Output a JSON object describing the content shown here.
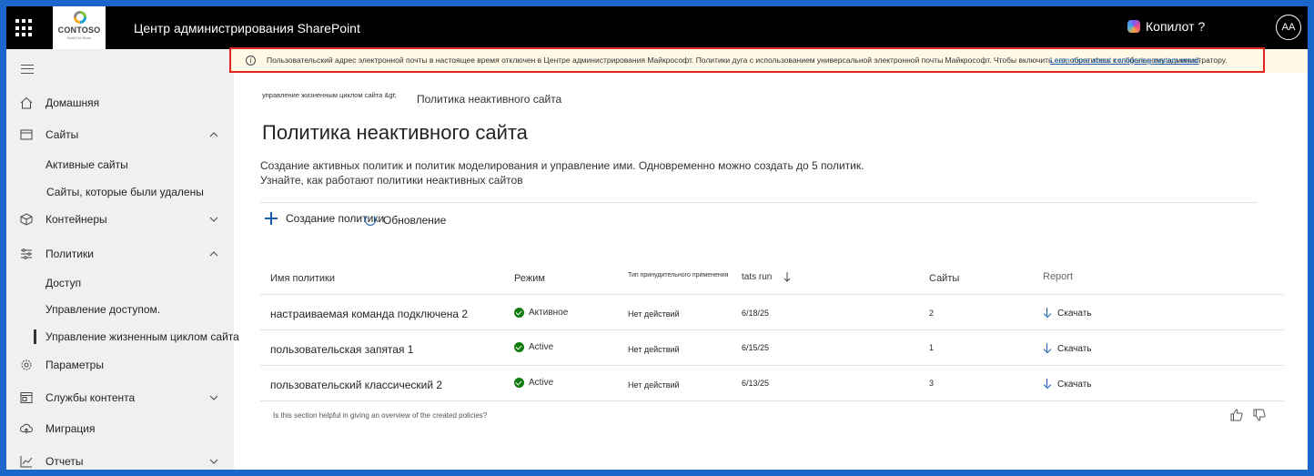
{
  "topbar": {
    "app_title": "Центр администрирования SharePoint",
    "logo_text": "CONTOSO",
    "logo_sub": "Build Ltd Story",
    "copilot_label": "Копилот ?",
    "avatar_initials": "AA"
  },
  "banner": {
    "text": "Пользовательский адрес электронной почты в настоящее время отключен в Центре администрирования Майкрософт. Политики дуга с использованием универсальной электронной почты Майкрософт. Чтобы включить его, обратитесь к глобальному администратору.",
    "link": "Learn more about configuring custom email"
  },
  "sidebar": {
    "items": [
      {
        "label": "Домашняя",
        "icon": "home-icon"
      },
      {
        "label": "Сайты",
        "icon": "sites-icon",
        "expanded": true
      },
      {
        "label": "Активные сайты"
      },
      {
        "label": "Сайты, которые были удалены"
      },
      {
        "label": "Контейнеры",
        "icon": "containers-icon",
        "expanded": false
      },
      {
        "label": "Политики",
        "icon": "policies-icon",
        "expanded": true
      },
      {
        "label": "Доступ"
      },
      {
        "label": "Управление доступом."
      },
      {
        "label": "Управление жизненным циклом сайта",
        "selected": true
      },
      {
        "label": "Параметры",
        "icon": "settings-icon"
      },
      {
        "label": "Службы контента",
        "icon": "content-services-icon",
        "expanded": false
      },
      {
        "label": "Миграция",
        "icon": "migration-icon"
      },
      {
        "label": "Отчеты",
        "icon": "reports-icon",
        "expanded": false
      }
    ]
  },
  "main": {
    "breadcrumb_parent": "управление жизненным циклом сайта &gt;",
    "breadcrumb_current": "Политика неактивного сайта",
    "title": "Политика неактивного сайта",
    "description": "Создание активных политик и политик моделирования и управление ими. Одновременно можно создать до 5 политик.",
    "learn_link": "Узнайте, как работают политики неактивных сайтов",
    "create_label": "Создание политики",
    "refresh_label": "Обновление"
  },
  "table": {
    "headers": {
      "name": "Имя политики",
      "mode": "Режим",
      "enforcement": "Тип принудительного применения",
      "last_run": "tats run",
      "sites": "Сайты",
      "report": "Report"
    },
    "rows": [
      {
        "name": "настраиваемая команда подключена 2",
        "mode": "Активное",
        "enforcement": "Нет действий",
        "last_run": "6/18/25",
        "sites": "2",
        "report": "Скачать"
      },
      {
        "name": "пользовательская запятая 1",
        "mode": "Active",
        "enforcement": "Нет действий",
        "last_run": "6/15/25",
        "sites": "1",
        "report": "Скачать"
      },
      {
        "name": "пользовательский классический 2",
        "mode": "Active",
        "enforcement": "Нет действий",
        "last_run": "6/13/25",
        "sites": "3",
        "report": "Скачать"
      }
    ],
    "feedback_question": "Is this section helpful in giving an overview of the created policies?"
  }
}
